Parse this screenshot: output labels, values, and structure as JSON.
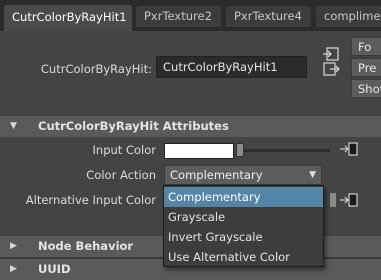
{
  "tabs": [
    {
      "label": "CutrColorByRayHit1",
      "active": true
    },
    {
      "label": "PxrTexture2",
      "active": false
    },
    {
      "label": "PxrTexture4",
      "active": false
    },
    {
      "label": "complime",
      "active": false
    }
  ],
  "node": {
    "label": "CutrColorByRayHit:",
    "value": "CutrColorByRayHit1"
  },
  "side_buttons": [
    "Fo",
    "Pre",
    "Show"
  ],
  "attributes_section": {
    "title": "CutrColorByRayHit Attributes",
    "expanded": true,
    "input_color_label": "Input Color",
    "input_color_value": "#ffffff",
    "color_action_label": "Color Action",
    "color_action_value": "Complementary",
    "alt_input_color_label": "Alternative Input Color"
  },
  "color_action_menu": {
    "options": [
      "Complementary",
      "Grayscale",
      "Invert Grayscale",
      "Use Alternative Color"
    ],
    "selected_index": 0,
    "highlight_color": "#5285a6"
  },
  "collapsed_sections": [
    "Node Behavior",
    "UUID"
  ],
  "colors": {
    "background": "#444444",
    "section_header": "#5a5a5a",
    "tabbar": "#2b2b2b"
  }
}
